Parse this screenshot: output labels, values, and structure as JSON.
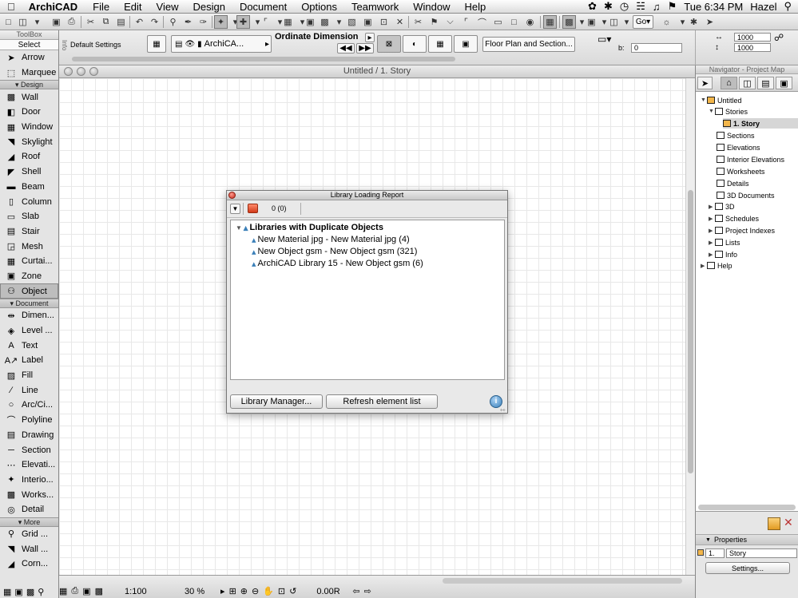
{
  "menubar": {
    "app_name": "ArchiCAD",
    "menus": [
      "File",
      "Edit",
      "View",
      "Design",
      "Document",
      "Options",
      "Teamwork",
      "Window",
      "Help"
    ],
    "clock": "Tue 6:34 PM",
    "user": "Hazel"
  },
  "toolbar": {
    "go_label": "Go"
  },
  "infobox": {
    "side_label": "Info",
    "default_settings": "Default Settings",
    "layer_value": "ArchiCA...",
    "dimension_title": "Ordinate Dimension",
    "view_button": "Floor Plan and Section...",
    "b_label": "b:",
    "b_value": "0",
    "size_w": "1000",
    "size_h": "1000"
  },
  "toolbox": {
    "title": "ToolBox",
    "select_label": "Select",
    "top_tools": [
      {
        "label": "Arrow",
        "icon": "arrow-icon"
      },
      {
        "label": "Marquee",
        "icon": "marquee-icon"
      }
    ],
    "design_label": "Design",
    "design_tools": [
      {
        "label": "Wall",
        "icon": "wall-icon"
      },
      {
        "label": "Door",
        "icon": "door-icon"
      },
      {
        "label": "Window",
        "icon": "window-icon"
      },
      {
        "label": "Skylight",
        "icon": "skylight-icon"
      },
      {
        "label": "Roof",
        "icon": "roof-icon"
      },
      {
        "label": "Shell",
        "icon": "shell-icon"
      },
      {
        "label": "Beam",
        "icon": "beam-icon"
      },
      {
        "label": "Column",
        "icon": "column-icon"
      },
      {
        "label": "Slab",
        "icon": "slab-icon"
      },
      {
        "label": "Stair",
        "icon": "stair-icon"
      },
      {
        "label": "Mesh",
        "icon": "mesh-icon"
      },
      {
        "label": "Curtai...",
        "icon": "curtain-wall-icon"
      },
      {
        "label": "Zone",
        "icon": "zone-icon"
      },
      {
        "label": "Object",
        "icon": "object-icon"
      }
    ],
    "document_label": "Document",
    "document_tools": [
      {
        "label": "Dimen...",
        "icon": "dimension-icon"
      },
      {
        "label": "Level ...",
        "icon": "level-dimension-icon"
      },
      {
        "label": "Text",
        "icon": "text-icon"
      },
      {
        "label": "Label",
        "icon": "label-icon"
      },
      {
        "label": "Fill",
        "icon": "fill-icon"
      },
      {
        "label": "Line",
        "icon": "line-icon"
      },
      {
        "label": "Arc/Ci...",
        "icon": "arc-icon"
      },
      {
        "label": "Polyline",
        "icon": "polyline-icon"
      },
      {
        "label": "Drawing",
        "icon": "drawing-icon"
      },
      {
        "label": "Section",
        "icon": "section-icon"
      },
      {
        "label": "Elevati...",
        "icon": "elevation-icon"
      },
      {
        "label": "Interio...",
        "icon": "interior-elevation-icon"
      },
      {
        "label": "Works...",
        "icon": "worksheet-icon"
      },
      {
        "label": "Detail",
        "icon": "detail-icon"
      }
    ],
    "more_label": "More",
    "more_tools": [
      {
        "label": "Grid ...",
        "icon": "grid-icon"
      },
      {
        "label": "Wall ...",
        "icon": "wall-end-icon"
      },
      {
        "label": "Corn...",
        "icon": "corner-window-icon"
      }
    ],
    "selected_tool": "Object"
  },
  "main_window": {
    "title": "Untitled / 1. Story",
    "scale": "1:100",
    "zoom": "30 %",
    "angle": "0.00R"
  },
  "dialog": {
    "title": "Library Loading Report",
    "count": "0 (0)",
    "group_header": "Libraries with Duplicate Objects",
    "items": [
      "New Material jpg - New Material jpg (4)",
      "New Object gsm - New Object gsm (321)",
      "ArchiCAD Library 15 - New Object gsm (6)"
    ],
    "library_manager_button": "Library Manager...",
    "refresh_button": "Refresh element list"
  },
  "navigator": {
    "title": "Navigator - Project Map",
    "root": "Untitled",
    "stories_label": "Stories",
    "current_story": "1. Story",
    "items": [
      "Sections",
      "Elevations",
      "Interior Elevations",
      "Worksheets",
      "Details",
      "3D Documents"
    ],
    "collapsed_items": [
      "3D",
      "Schedules",
      "Project Indexes",
      "Lists",
      "Info"
    ],
    "help_label": "Help"
  },
  "properties": {
    "title": "Properties",
    "story_number": "1.",
    "story_name": "Story",
    "settings_button": "Settings..."
  }
}
